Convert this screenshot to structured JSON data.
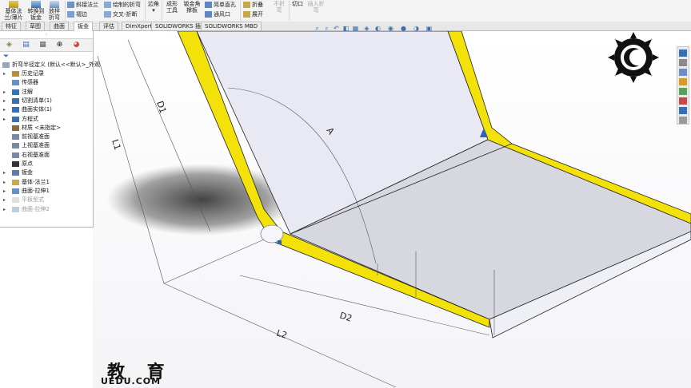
{
  "ribbon": {
    "items": [
      {
        "label": "基体法兰/薄片",
        "disabled": false
      },
      {
        "label": "转换到钣金",
        "disabled": false
      },
      {
        "label": "放样折弯",
        "disabled": false
      }
    ],
    "small": {
      "edge_flange": "斜接法兰",
      "hem": "褶边",
      "sketched_bend": "绘制的折弯",
      "cross_break": "交叉-折断",
      "corners": "边角",
      "forming_tool": "成形工具",
      "gusset": "钣金角撑板",
      "simple_hole": "简单直孔",
      "vent": "通风口",
      "fold": "折叠",
      "unfold": "展开",
      "no_bend": "不折弯",
      "cut": "切口",
      "insert_bend": "插入折弯"
    }
  },
  "tabs": [
    {
      "label": "特征",
      "active": false
    },
    {
      "label": "草图",
      "active": false
    },
    {
      "label": "曲面",
      "active": false
    },
    {
      "label": "钣金",
      "active": true
    },
    {
      "label": "评估",
      "active": false
    },
    {
      "label": "DimXpert",
      "active": false
    },
    {
      "label": "SOLIDWORKS 插件",
      "active": false
    },
    {
      "label": "SOLIDWORKS MBD",
      "active": false
    }
  ],
  "tree": {
    "root": "折弯半径定义 (默认<<默认>_外观",
    "items": [
      {
        "label": "历史记录",
        "icon": "history-icon",
        "expand": true,
        "dim": false
      },
      {
        "label": "传感器",
        "icon": "sensor-icon",
        "expand": false,
        "dim": false
      },
      {
        "label": "注解",
        "icon": "annotation-icon",
        "expand": true,
        "dim": false
      },
      {
        "label": "切割清单(1)",
        "icon": "cutlist-icon",
        "expand": true,
        "dim": false
      },
      {
        "label": "曲面实体(1)",
        "icon": "surface-body-icon",
        "expand": true,
        "dim": false
      },
      {
        "label": "方程式",
        "icon": "equation-icon",
        "expand": true,
        "dim": false
      },
      {
        "label": "材质 <未指定>",
        "icon": "material-icon",
        "expand": false,
        "dim": false
      },
      {
        "label": "前视基准面",
        "icon": "plane-icon",
        "expand": false,
        "dim": false
      },
      {
        "label": "上视基准面",
        "icon": "plane-icon",
        "expand": false,
        "dim": false
      },
      {
        "label": "右视基准面",
        "icon": "plane-icon",
        "expand": false,
        "dim": false
      },
      {
        "label": "原点",
        "icon": "origin-icon",
        "expand": false,
        "dim": false
      },
      {
        "label": "钣金",
        "icon": "sheetmetal-icon",
        "expand": true,
        "dim": false
      },
      {
        "label": "基体-法兰1",
        "icon": "base-flange-icon",
        "expand": true,
        "dim": false
      },
      {
        "label": "曲面-拉伸1",
        "icon": "surface-extrude-icon",
        "expand": true,
        "dim": false
      },
      {
        "label": "平板型式",
        "icon": "flat-pattern-icon",
        "expand": true,
        "dim": true
      },
      {
        "label": "曲面-拉伸2",
        "icon": "surface-extrude-icon",
        "expand": true,
        "dim": true
      }
    ]
  },
  "dimensions": {
    "d1": "D1",
    "l1": "L1",
    "a": "A",
    "d2": "D2",
    "l2": "L2"
  },
  "watermark": {
    "cn": "教 育",
    "en": "UEDU.COM"
  },
  "colors": {
    "flange_edge": "#f2e20a",
    "face": "#e9e9f4",
    "floor": "#d7d7df",
    "accent": "#2a63b8"
  }
}
